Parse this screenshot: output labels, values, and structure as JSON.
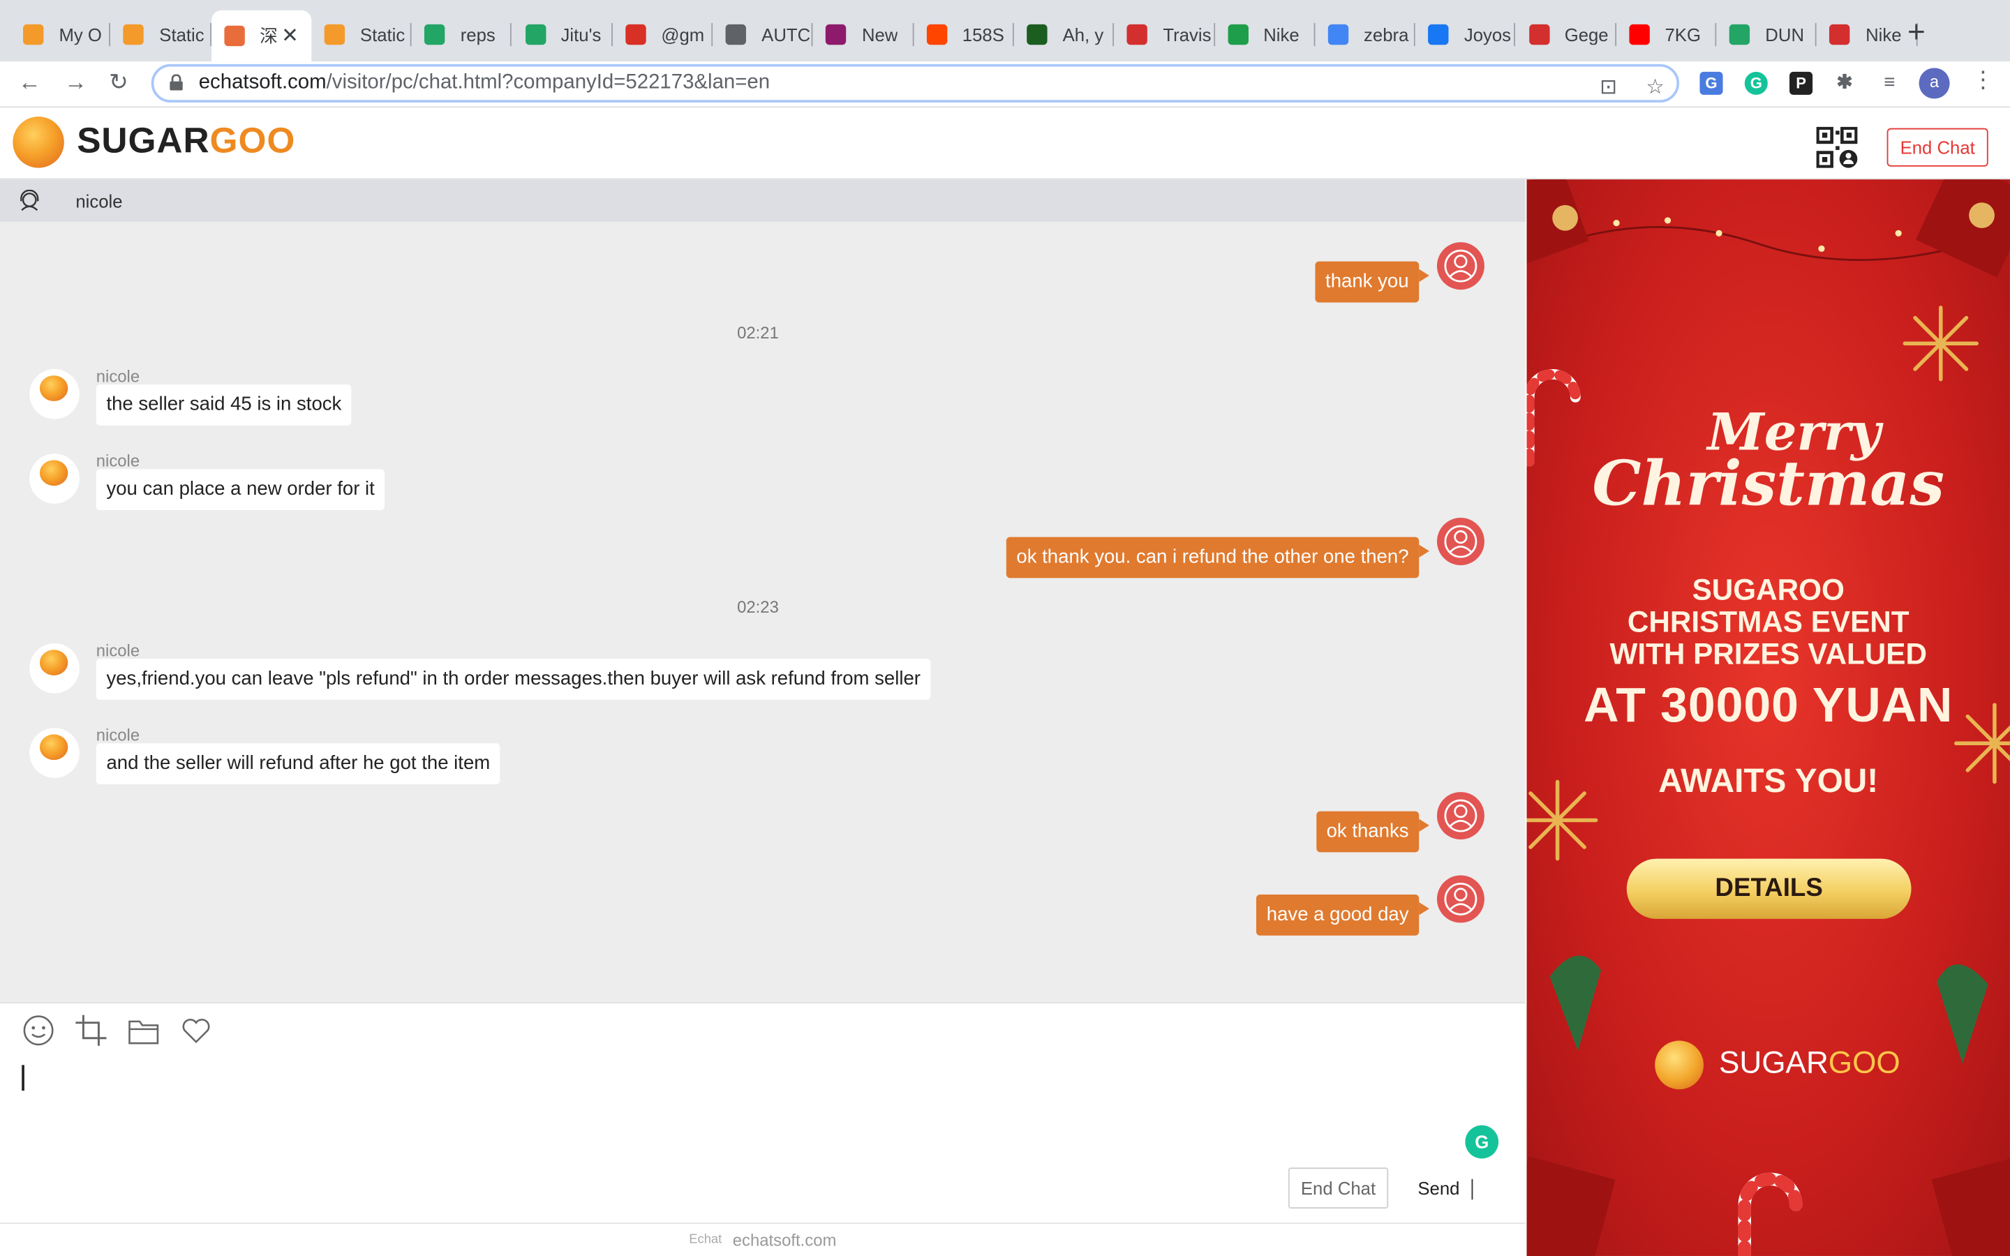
{
  "browser": {
    "tabs": [
      {
        "label": "My O",
        "favicon": "sugargoo-icon",
        "color": "#f39a2b"
      },
      {
        "label": "Static",
        "favicon": "sugargoo-icon",
        "color": "#f39a2b"
      },
      {
        "label": "深",
        "favicon": "echat-icon",
        "color": "#e96c3b",
        "active": true
      },
      {
        "label": "Static",
        "favicon": "sugargoo-icon",
        "color": "#f39a2b"
      },
      {
        "label": "reps",
        "favicon": "sheets-icon",
        "color": "#23a566"
      },
      {
        "label": "Jitu's",
        "favicon": "sheets-icon",
        "color": "#23a566"
      },
      {
        "label": "@gm",
        "favicon": "calendar-icon",
        "color": "#d93025"
      },
      {
        "label": "AUTC",
        "favicon": "globe-icon",
        "color": "#5f6368"
      },
      {
        "label": "New",
        "favicon": "lf-icon",
        "color": "#8e1a6b"
      },
      {
        "label": "158S",
        "favicon": "reddit-icon",
        "color": "#ff4500"
      },
      {
        "label": "Ah, y",
        "favicon": "app-icon",
        "color": "#1b5e20"
      },
      {
        "label": "Travis",
        "favicon": "store-icon",
        "color": "#d32f2f"
      },
      {
        "label": "Nike",
        "favicon": "x-icon",
        "color": "#1e9e4a"
      },
      {
        "label": "zebra",
        "favicon": "google-icon",
        "color": "#4285f4"
      },
      {
        "label": "Joyos",
        "favicon": "facebook-icon",
        "color": "#1877f2"
      },
      {
        "label": "Gege",
        "favicon": "store-icon",
        "color": "#d32f2f"
      },
      {
        "label": "7KG",
        "favicon": "youtube-icon",
        "color": "#ff0000"
      },
      {
        "label": "DUN",
        "favicon": "sheets-icon",
        "color": "#23a566"
      },
      {
        "label": "Nike",
        "favicon": "store-icon",
        "color": "#d32f2f"
      }
    ],
    "url_host": "echatsoft.com",
    "url_path": "/visitor/pc/chat.html?companyId=522173&lan=en",
    "profile_initial": "a"
  },
  "header": {
    "logo_sugar": "SUGAR",
    "logo_goo": "GOO",
    "end_chat_label": "End Chat"
  },
  "agent": {
    "name": "nicole"
  },
  "messages": [
    {
      "from": "user",
      "text": "thank you"
    },
    {
      "timestamp": "02:21"
    },
    {
      "from": "agent",
      "name": "nicole",
      "text": "the seller said 45 is in stock"
    },
    {
      "from": "agent",
      "name": "nicole",
      "text": "you can place a new order for it"
    },
    {
      "from": "user",
      "text": "ok thank you. can i refund the other one then?"
    },
    {
      "timestamp": "02:23"
    },
    {
      "from": "agent",
      "name": "nicole",
      "text": "yes,friend.you can leave \"pls refund\" in th order messages.then buyer will ask refund from seller"
    },
    {
      "from": "agent",
      "name": "nicole",
      "text": "and the seller will refund after he got the item"
    },
    {
      "from": "user",
      "text": "ok thanks"
    },
    {
      "from": "user",
      "text": "have a good day"
    }
  ],
  "composer": {
    "tools": [
      "emoji-icon",
      "crop-icon",
      "folder-icon",
      "heart-icon"
    ],
    "input_value": "",
    "end_chat_label": "End Chat",
    "send_label": "Send"
  },
  "footer": {
    "brand": "Echat",
    "site": "echatsoft.com"
  },
  "banner": {
    "merry": "Merry",
    "christmas": "Christmas",
    "line1": "SUGAROO",
    "line2": "CHRISTMAS EVENT",
    "line3": "WITH PRIZES VALUED",
    "line4": "AT 30000 YUAN",
    "line5": "AWAITS YOU!",
    "details_label": "DETAILS",
    "logo_sugar": "SUGAR",
    "logo_goo": "GOO"
  },
  "colors": {
    "accent": "#e07a2f",
    "user_avatar": "#e25552",
    "end_chat": "#e53935",
    "banner_red": "#c81e1c"
  }
}
